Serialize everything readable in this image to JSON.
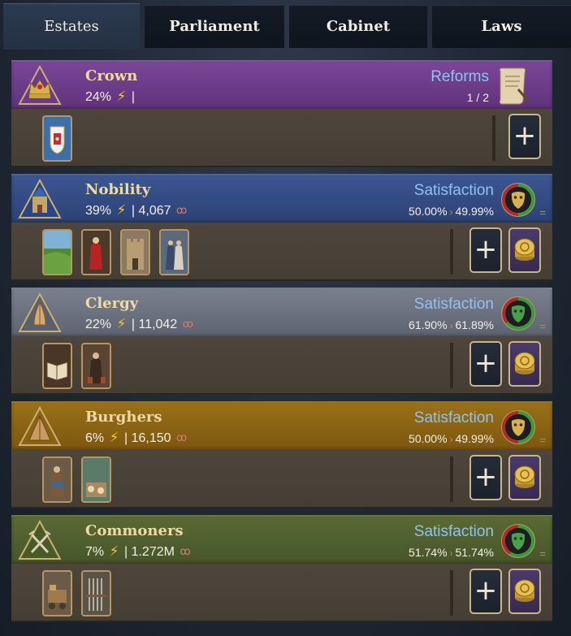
{
  "tabs": [
    {
      "label": "Estates",
      "active": true
    },
    {
      "label": "Parliament",
      "active": false
    },
    {
      "label": "Cabinet",
      "active": false
    },
    {
      "label": "Laws",
      "active": false
    }
  ],
  "colors": {
    "crown": "#6a3a86",
    "nobility": "#2f4880",
    "clergy": "#6a7180",
    "burghers": "#8a6414",
    "commoners": "#4e5e2a",
    "accent_blue": "#8fc2ee",
    "name_gold": "#f0d9a4"
  },
  "crown": {
    "name": "Crown",
    "influence": "24%",
    "suffix": "|",
    "right_label": "Reforms",
    "right_value": "1 / 2",
    "icon": "crown-icon",
    "cards": [
      "coat-of-arms-card"
    ]
  },
  "nobility": {
    "name": "Nobility",
    "influence": "39%",
    "population": "| 4,067",
    "right_label": "Satisfaction",
    "sat_from": "50.00%",
    "sat_to": "49.99%",
    "icon": "castle-icon",
    "cards": [
      "landscape-card",
      "royal-figure-card",
      "fortress-card",
      "noble-couple-card"
    ]
  },
  "clergy": {
    "name": "Clergy",
    "influence": "22%",
    "population": "| 11,042",
    "right_label": "Satisfaction",
    "sat_from": "61.90%",
    "sat_to": "61.89%",
    "icon": "praying-hands-icon",
    "cards": [
      "scripture-card",
      "monks-card"
    ]
  },
  "burghers": {
    "name": "Burghers",
    "influence": "6%",
    "population": "| 16,150",
    "right_label": "Satisfaction",
    "sat_from": "50.00%",
    "sat_to": "49.99%",
    "icon": "tent-icon",
    "cards": [
      "merchant-card",
      "workshop-card"
    ]
  },
  "commoners": {
    "name": "Commoners",
    "influence": "7%",
    "population": "| 1.272M",
    "right_label": "Satisfaction",
    "sat_from": "51.74%",
    "sat_to": "51.74%",
    "icon": "pitchfork-icon",
    "cards": [
      "cart-card",
      "weapons-rack-card"
    ]
  },
  "symbols": {
    "arrow": "›",
    "eq": "=",
    "plus": "+",
    "bolt": "⚡",
    "people": "ꝏ"
  }
}
